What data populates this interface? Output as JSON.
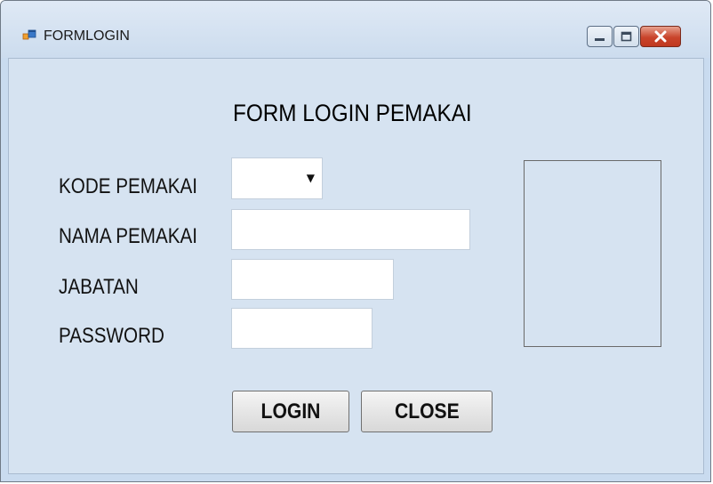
{
  "window": {
    "title": "FORMLOGIN",
    "icon": "form-app-icon",
    "controls": {
      "minimize_icon": "minimize-icon",
      "maximize_icon": "maximize-icon",
      "close_icon": "close-icon"
    },
    "colors": {
      "client_background": "#d6e3f1",
      "close_button": "#c9442b"
    }
  },
  "form": {
    "heading": "FORM LOGIN PEMAKAI",
    "fields": {
      "kode_pemakai": {
        "label": "KODE PEMAKAI",
        "value": ""
      },
      "nama_pemakai": {
        "label": "NAMA PEMAKAI",
        "value": ""
      },
      "jabatan": {
        "label": "JABATAN",
        "value": ""
      },
      "password": {
        "label": "PASSWORD",
        "value": ""
      }
    },
    "buttons": {
      "login": "LOGIN",
      "close": "CLOSE"
    }
  }
}
